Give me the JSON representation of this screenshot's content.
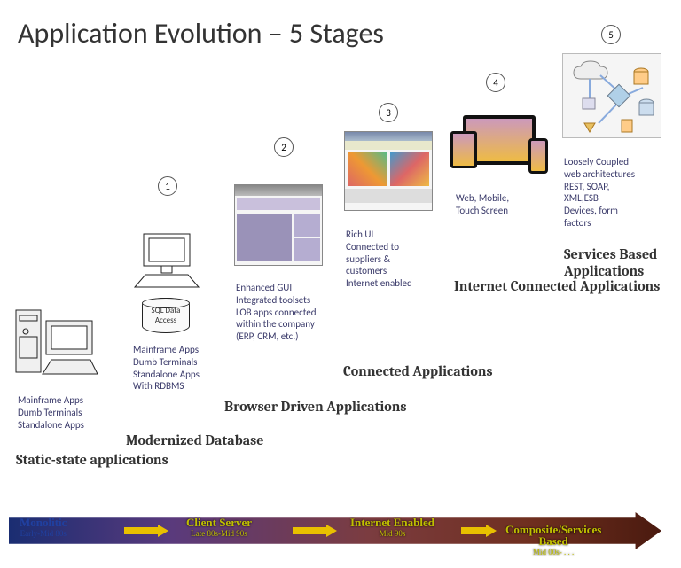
{
  "title": "Application Evolution – 5 Stages",
  "stages": [
    {
      "num": "1",
      "desc": "Mainframe Apps\nDumb Terminals\nStandalone Apps",
      "title": "Static-state\napplications",
      "extra_desc": "Mainframe Apps\nDumb Terminals\nStandalone Apps\nWith RDBMS",
      "extra_title": "Modernized\nDatabase",
      "sql_label": "SQL Data\nAccess"
    },
    {
      "num": "2",
      "desc": "Enhanced GUI\nIntegrated toolsets\nLOB apps connected\nwithin the company\n(ERP, CRM, etc.)",
      "title": "Browser Driven\nApplications"
    },
    {
      "num": "3",
      "desc": "Rich UI\nConnected to\nsuppliers &\ncustomers\nInternet enabled",
      "title": "Connected\nApplications"
    },
    {
      "num": "4",
      "desc": "Web, Mobile,\nTouch Screen",
      "title": "Internet\nConnected\nApplications"
    },
    {
      "num": "5",
      "desc": "Loosely Coupled\nweb architectures\nREST, SOAP,\nXML,ESB\nDevices, form\nfactors",
      "title": "Services\nBased\nApplications"
    }
  ],
  "timeline": [
    {
      "label": "Monolitic",
      "sub": "Early-Mid 80s"
    },
    {
      "label": "Client Server",
      "sub": "Late 80s-Mid 90s"
    },
    {
      "label": "Internet Enabled",
      "sub": "Mid 90s"
    },
    {
      "label": "Composite/Services\nBased",
      "sub": "Mid 00s- . . ."
    }
  ]
}
